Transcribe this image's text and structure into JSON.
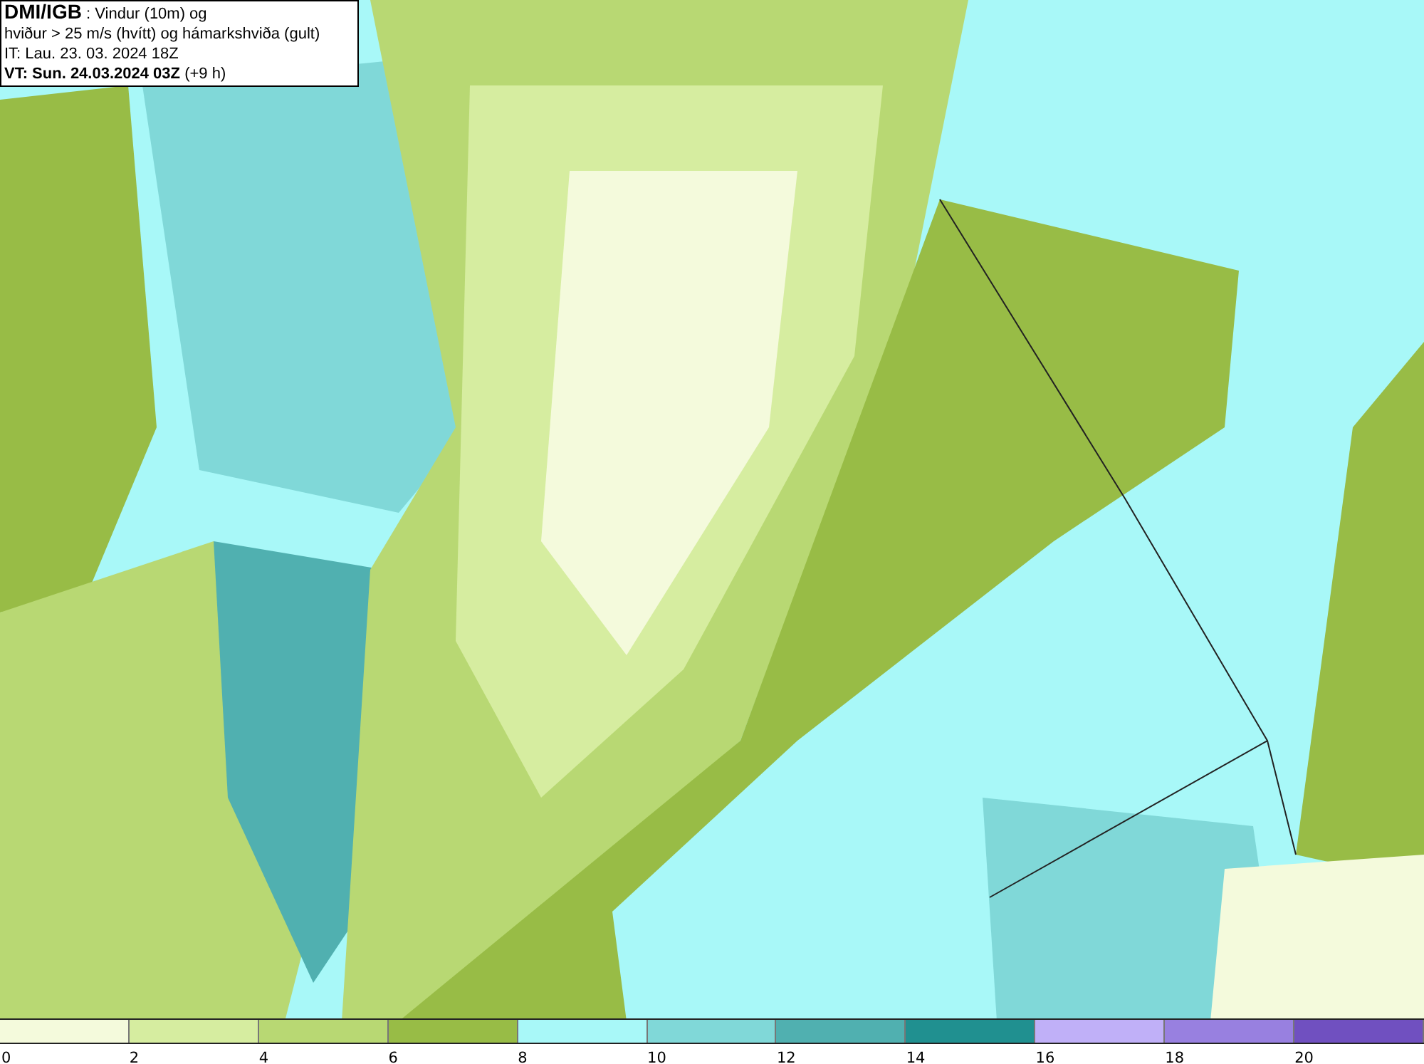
{
  "header": {
    "lines": [
      "**DMI/IGB** : Vindur (10m) og",
      "hviður > 25 m/s (hvítt) og hámarkshviða (gult)",
      "IT: Lau. 23. 03. 2024 18Z",
      "**VT: Sun. 24.03.2024 03Z** (+9 h)"
    ]
  },
  "legend": {
    "items": [
      {
        "label": "0",
        "color": "#f4fadc"
      },
      {
        "label": "2",
        "color": "#d6eda0"
      },
      {
        "label": "4",
        "color": "#b8d873"
      },
      {
        "label": "6",
        "color": "#98bc46"
      },
      {
        "label": "8",
        "color": "#a8f8f8"
      },
      {
        "label": "10",
        "color": "#80d8d8"
      },
      {
        "label": "12",
        "color": "#50b0b0"
      },
      {
        "label": "14",
        "color": "#209090"
      },
      {
        "label": "16",
        "color": "#c0b0f8"
      },
      {
        "label": "18",
        "color": "#9880e0"
      },
      {
        "label": "20",
        "color": "#7050c0"
      }
    ]
  }
}
